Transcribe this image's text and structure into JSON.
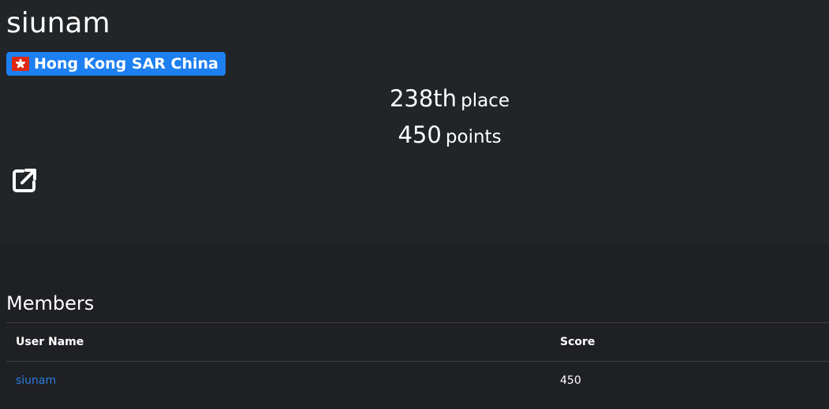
{
  "team": {
    "name": "siunam",
    "country": "Hong Kong SAR China",
    "flag_icon": "hong-kong-flag-icon",
    "place_number": "238th",
    "place_label": "place",
    "points_number": "450",
    "points_label": "points",
    "external_link_icon": "external-link-icon"
  },
  "members": {
    "title": "Members",
    "columns": [
      "User Name",
      "Score"
    ],
    "rows": [
      {
        "user": "siunam",
        "score": "450"
      }
    ]
  },
  "colors": {
    "page_background": "#1f2023",
    "hero_background": "#222528",
    "badge_background": "#1d7ff0",
    "link": "#2a7de1",
    "flag_red": "#de2910"
  }
}
